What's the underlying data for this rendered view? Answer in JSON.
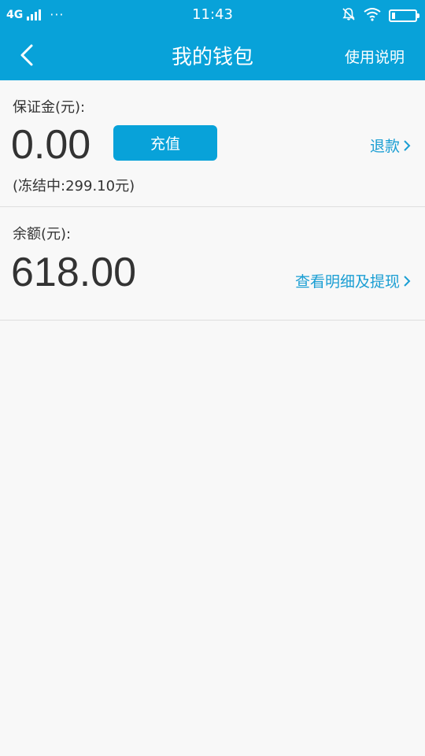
{
  "status_bar": {
    "network": "4G",
    "dots": "···",
    "time": "11:43",
    "battery_percent": 15
  },
  "header": {
    "title": "我的钱包",
    "help_label": "使用说明"
  },
  "deposit": {
    "label": "保证金(元):",
    "amount": "0.00",
    "recharge_label": "充值",
    "frozen_text": "(冻结中:299.10元)",
    "refund_label": "退款"
  },
  "balance": {
    "label": "余额(元):",
    "amount": "618.00",
    "details_label": "查看明细及提现"
  },
  "colors": {
    "accent": "#08a2d9",
    "link": "#1a9ed3",
    "background": "#f8f8f8"
  }
}
